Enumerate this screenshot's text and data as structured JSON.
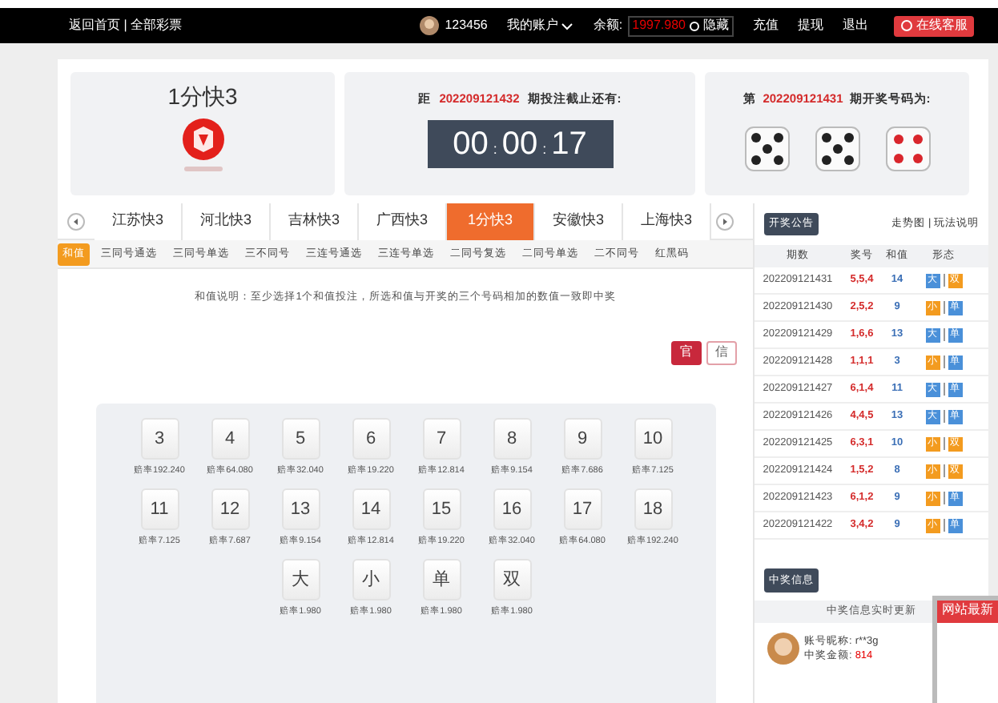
{
  "top_bar": {
    "home_links": "返回首页 | 全部彩票",
    "username": "123456",
    "account_menu": "我的账户",
    "balance_label": "余额:",
    "balance": "1997.980",
    "hide_label": "隐藏",
    "actions": [
      "充值",
      "提现",
      "退出"
    ],
    "service": "在线客服"
  },
  "game": {
    "title": "1分快3"
  },
  "countdown": {
    "prefix": "距",
    "issue": "202209121432",
    "suffix": "期投注截止还有:",
    "segments": [
      "00",
      "00",
      "17"
    ],
    "separator": ":"
  },
  "last_draw": {
    "prefix": "第",
    "issue": "202209121431",
    "suffix": "期开奖号码为:",
    "dice": [
      {
        "kind": "five",
        "color": "#222222"
      },
      {
        "kind": "five",
        "color": "#222222"
      },
      {
        "kind": "four",
        "color": "#d9262c"
      }
    ]
  },
  "tabs": [
    {
      "label": "江苏快3",
      "selected": false
    },
    {
      "label": "河北快3",
      "selected": false
    },
    {
      "label": "吉林快3",
      "selected": false
    },
    {
      "label": "广西快3",
      "selected": false
    },
    {
      "label": "1分快3",
      "selected": true
    },
    {
      "label": "安徽快3",
      "selected": false
    },
    {
      "label": "上海快3",
      "selected": false
    }
  ],
  "sub_tabs": [
    {
      "label": "和值",
      "selected": true
    },
    {
      "label": "三同号通选",
      "selected": false
    },
    {
      "label": "三同号单选",
      "selected": false
    },
    {
      "label": "三不同号",
      "selected": false
    },
    {
      "label": "三连号通选",
      "selected": false
    },
    {
      "label": "三连号单选",
      "selected": false
    },
    {
      "label": "二同号复选",
      "selected": false
    },
    {
      "label": "二同号单选",
      "selected": false
    },
    {
      "label": "二不同号",
      "selected": false
    },
    {
      "label": "红黑码",
      "selected": false
    }
  ],
  "rule_text": "和值说明：至少选择1个和值投注，所选和值与开奖的三个号码相加的数值一致即中奖",
  "mode_buttons": [
    {
      "label": "官",
      "selected": true
    },
    {
      "label": "信",
      "selected": false
    }
  ],
  "bet_rows": [
    [
      {
        "number": "3",
        "odds": "赔率192.240"
      },
      {
        "number": "4",
        "odds": "赔率64.080"
      },
      {
        "number": "5",
        "odds": "赔率32.040"
      },
      {
        "number": "6",
        "odds": "赔率19.220"
      },
      {
        "number": "7",
        "odds": "赔率12.814"
      },
      {
        "number": "8",
        "odds": "赔率9.154"
      },
      {
        "number": "9",
        "odds": "赔率7.686"
      },
      {
        "number": "10",
        "odds": "赔率7.125"
      }
    ],
    [
      {
        "number": "11",
        "odds": "赔率7.125"
      },
      {
        "number": "12",
        "odds": "赔率7.687"
      },
      {
        "number": "13",
        "odds": "赔率9.154"
      },
      {
        "number": "14",
        "odds": "赔率12.814"
      },
      {
        "number": "15",
        "odds": "赔率19.220"
      },
      {
        "number": "16",
        "odds": "赔率32.040"
      },
      {
        "number": "17",
        "odds": "赔率64.080"
      },
      {
        "number": "18",
        "odds": "赔率192.240"
      }
    ],
    [
      {
        "number": "大",
        "odds": "赔率1.980"
      },
      {
        "number": "小",
        "odds": "赔率1.980"
      },
      {
        "number": "单",
        "odds": "赔率1.980"
      },
      {
        "number": "双",
        "odds": "赔率1.980"
      }
    ]
  ],
  "results": {
    "title": "开奖公告",
    "links": "走势图 | 玩法说明",
    "columns": [
      "期数",
      "奖号",
      "和值",
      "形态"
    ],
    "rows": [
      {
        "issue": "202209121431",
        "numbers": "5,5,4",
        "sum": "14",
        "size": {
          "label": "大",
          "color": "#4a90d9"
        },
        "parity": {
          "label": "双",
          "color": "#f39b1f"
        }
      },
      {
        "issue": "202209121430",
        "numbers": "2,5,2",
        "sum": "9",
        "size": {
          "label": "小",
          "color": "#f39b1f"
        },
        "parity": {
          "label": "单",
          "color": "#4a90d9"
        }
      },
      {
        "issue": "202209121429",
        "numbers": "1,6,6",
        "sum": "13",
        "size": {
          "label": "大",
          "color": "#4a90d9"
        },
        "parity": {
          "label": "单",
          "color": "#4a90d9"
        }
      },
      {
        "issue": "202209121428",
        "numbers": "1,1,1",
        "sum": "3",
        "size": {
          "label": "小",
          "color": "#f39b1f"
        },
        "parity": {
          "label": "单",
          "color": "#4a90d9"
        }
      },
      {
        "issue": "202209121427",
        "numbers": "6,1,4",
        "sum": "11",
        "size": {
          "label": "大",
          "color": "#4a90d9"
        },
        "parity": {
          "label": "单",
          "color": "#4a90d9"
        }
      },
      {
        "issue": "202209121426",
        "numbers": "4,4,5",
        "sum": "13",
        "size": {
          "label": "大",
          "color": "#4a90d9"
        },
        "parity": {
          "label": "单",
          "color": "#4a90d9"
        }
      },
      {
        "issue": "202209121425",
        "numbers": "6,3,1",
        "sum": "10",
        "size": {
          "label": "小",
          "color": "#f39b1f"
        },
        "parity": {
          "label": "双",
          "color": "#f39b1f"
        }
      },
      {
        "issue": "202209121424",
        "numbers": "1,5,2",
        "sum": "8",
        "size": {
          "label": "小",
          "color": "#f39b1f"
        },
        "parity": {
          "label": "双",
          "color": "#f39b1f"
        }
      },
      {
        "issue": "202209121423",
        "numbers": "6,1,2",
        "sum": "9",
        "size": {
          "label": "小",
          "color": "#f39b1f"
        },
        "parity": {
          "label": "单",
          "color": "#4a90d9"
        }
      },
      {
        "issue": "202209121422",
        "numbers": "3,4,2",
        "sum": "9",
        "size": {
          "label": "小",
          "color": "#f39b1f"
        },
        "parity": {
          "label": "单",
          "color": "#4a90d9"
        }
      }
    ]
  },
  "winners": {
    "title": "中奖信息",
    "subtitle": "中奖信息实时更新",
    "items": [
      {
        "nickname_label": "账号昵称:",
        "nickname": "r**3g",
        "amount_label": "中奖金额:",
        "amount": "814"
      }
    ]
  },
  "popup": {
    "title": "网站最新"
  }
}
